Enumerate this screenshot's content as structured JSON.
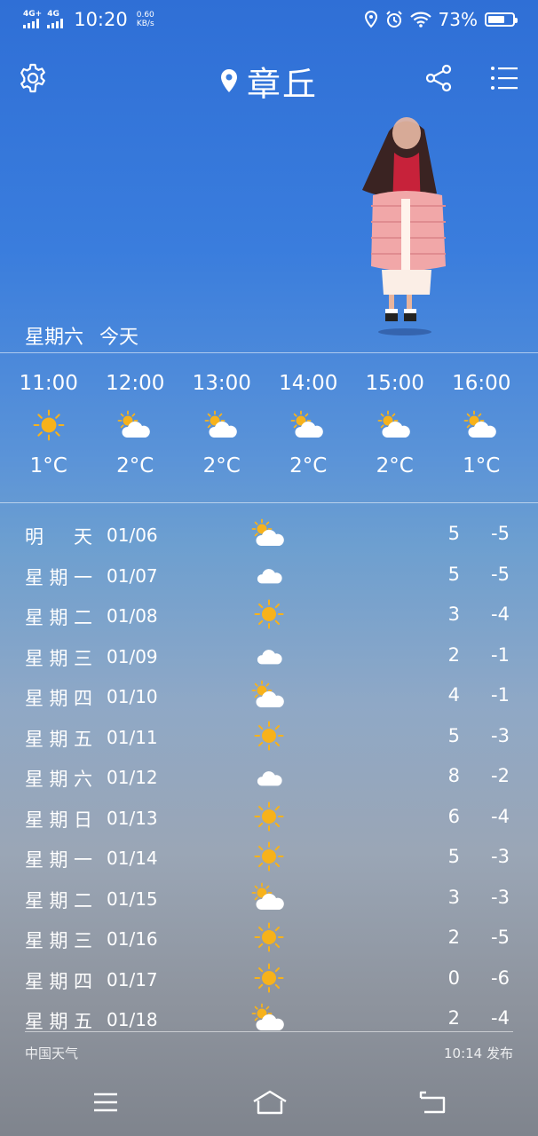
{
  "status_bar": {
    "signal1_label": "4G+",
    "signal2_label": "4G",
    "time": "10:20",
    "speed_value": "0.60",
    "speed_unit": "KB/s",
    "battery": "73%",
    "battery_level": 0.73
  },
  "header": {
    "city": "章丘",
    "icons": [
      "gear-icon",
      "location-pin-icon",
      "share-icon",
      "list-icon"
    ]
  },
  "today": {
    "weekday": "星期六",
    "label": "今天"
  },
  "hourly": [
    {
      "time": "11:00",
      "icon": "sun",
      "temp": "1°C"
    },
    {
      "time": "12:00",
      "icon": "partly-cloudy",
      "temp": "2°C"
    },
    {
      "time": "13:00",
      "icon": "partly-cloudy",
      "temp": "2°C"
    },
    {
      "time": "14:00",
      "icon": "partly-cloudy",
      "temp": "2°C"
    },
    {
      "time": "15:00",
      "icon": "partly-cloudy",
      "temp": "2°C"
    },
    {
      "time": "16:00",
      "icon": "partly-cloudy",
      "temp": "1°C"
    }
  ],
  "daily": [
    {
      "day": "明天",
      "date": "01/06",
      "icon": "partly-cloudy",
      "high": "5",
      "low": "-5"
    },
    {
      "day": "星期一",
      "date": "01/07",
      "icon": "cloud",
      "high": "5",
      "low": "-5"
    },
    {
      "day": "星期二",
      "date": "01/08",
      "icon": "sun",
      "high": "3",
      "low": "-4"
    },
    {
      "day": "星期三",
      "date": "01/09",
      "icon": "cloud",
      "high": "2",
      "low": "-1"
    },
    {
      "day": "星期四",
      "date": "01/10",
      "icon": "partly-cloudy",
      "high": "4",
      "low": "-1"
    },
    {
      "day": "星期五",
      "date": "01/11",
      "icon": "sun",
      "high": "5",
      "low": "-3"
    },
    {
      "day": "星期六",
      "date": "01/12",
      "icon": "cloud",
      "high": "8",
      "low": "-2"
    },
    {
      "day": "星期日",
      "date": "01/13",
      "icon": "sun",
      "high": "6",
      "low": "-4"
    },
    {
      "day": "星期一",
      "date": "01/14",
      "icon": "sun",
      "high": "5",
      "low": "-3"
    },
    {
      "day": "星期二",
      "date": "01/15",
      "icon": "partly-cloudy",
      "high": "3",
      "low": "-3"
    },
    {
      "day": "星期三",
      "date": "01/16",
      "icon": "sun",
      "high": "2",
      "low": "-5"
    },
    {
      "day": "星期四",
      "date": "01/17",
      "icon": "sun",
      "high": "0",
      "low": "-6"
    },
    {
      "day": "星期五",
      "date": "01/18",
      "icon": "partly-cloudy",
      "high": "2",
      "low": "-4"
    }
  ],
  "footer": {
    "source": "中国天气",
    "published": "10:14 发布"
  },
  "nav": {
    "icons": [
      "menu-icon",
      "home-icon",
      "back-icon"
    ]
  },
  "colors": {
    "sun": "#f7b21b",
    "cloud": "#ffffff",
    "sky_top": "#2f6fd6",
    "sky_bottom": "#7f848d"
  }
}
